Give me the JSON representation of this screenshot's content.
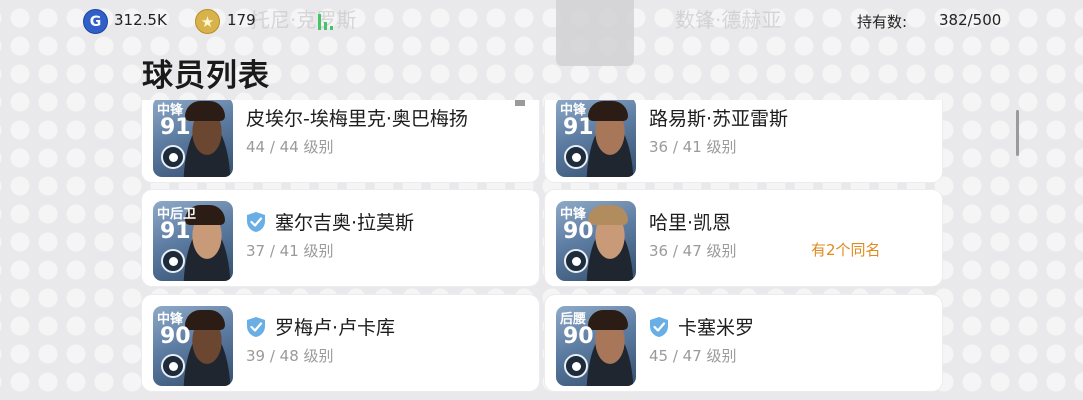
{
  "topbar": {
    "gp_icon_glyph": "G",
    "gp_value": "312.5K",
    "coin_icon_glyph": "★",
    "coin_value": "179",
    "holding_label": "持有数:",
    "holding_value": "382/500"
  },
  "page_title": "球员列表",
  "background": {
    "ghost_left": "托尼·克罗斯",
    "ghost_right": "数锋·德赫亚"
  },
  "players": [
    {
      "position": "中锋",
      "rating": "91",
      "name": "皮埃尔-埃梅里克·奥巴梅扬",
      "level": "44 / 44 级别",
      "verified": false,
      "note": ""
    },
    {
      "position": "中锋",
      "rating": "91",
      "name": "路易斯·苏亚雷斯",
      "level": "36 / 41 级别",
      "verified": false,
      "note": ""
    },
    {
      "position": "中后卫",
      "rating": "91",
      "name": "塞尔吉奥·拉莫斯",
      "level": "37 / 41 级别",
      "verified": true,
      "note": ""
    },
    {
      "position": "中锋",
      "rating": "90",
      "name": "哈里·凯恩",
      "level": "36 / 47 级别",
      "verified": false,
      "note": "有2个同名"
    },
    {
      "position": "中锋",
      "rating": "90",
      "name": "罗梅卢·卢卡库",
      "level": "39 / 48 级别",
      "verified": true,
      "note": ""
    },
    {
      "position": "后腰",
      "rating": "90",
      "name": "卡塞米罗",
      "level": "45 / 47 级别",
      "verified": true,
      "note": ""
    }
  ],
  "colors": {
    "gp_blue": "#2f5fc7",
    "coin_gold": "#d8b24a",
    "verified_blue": "#6aaee6",
    "note_orange": "#e08a1e",
    "card_bg": "#ffffff"
  }
}
